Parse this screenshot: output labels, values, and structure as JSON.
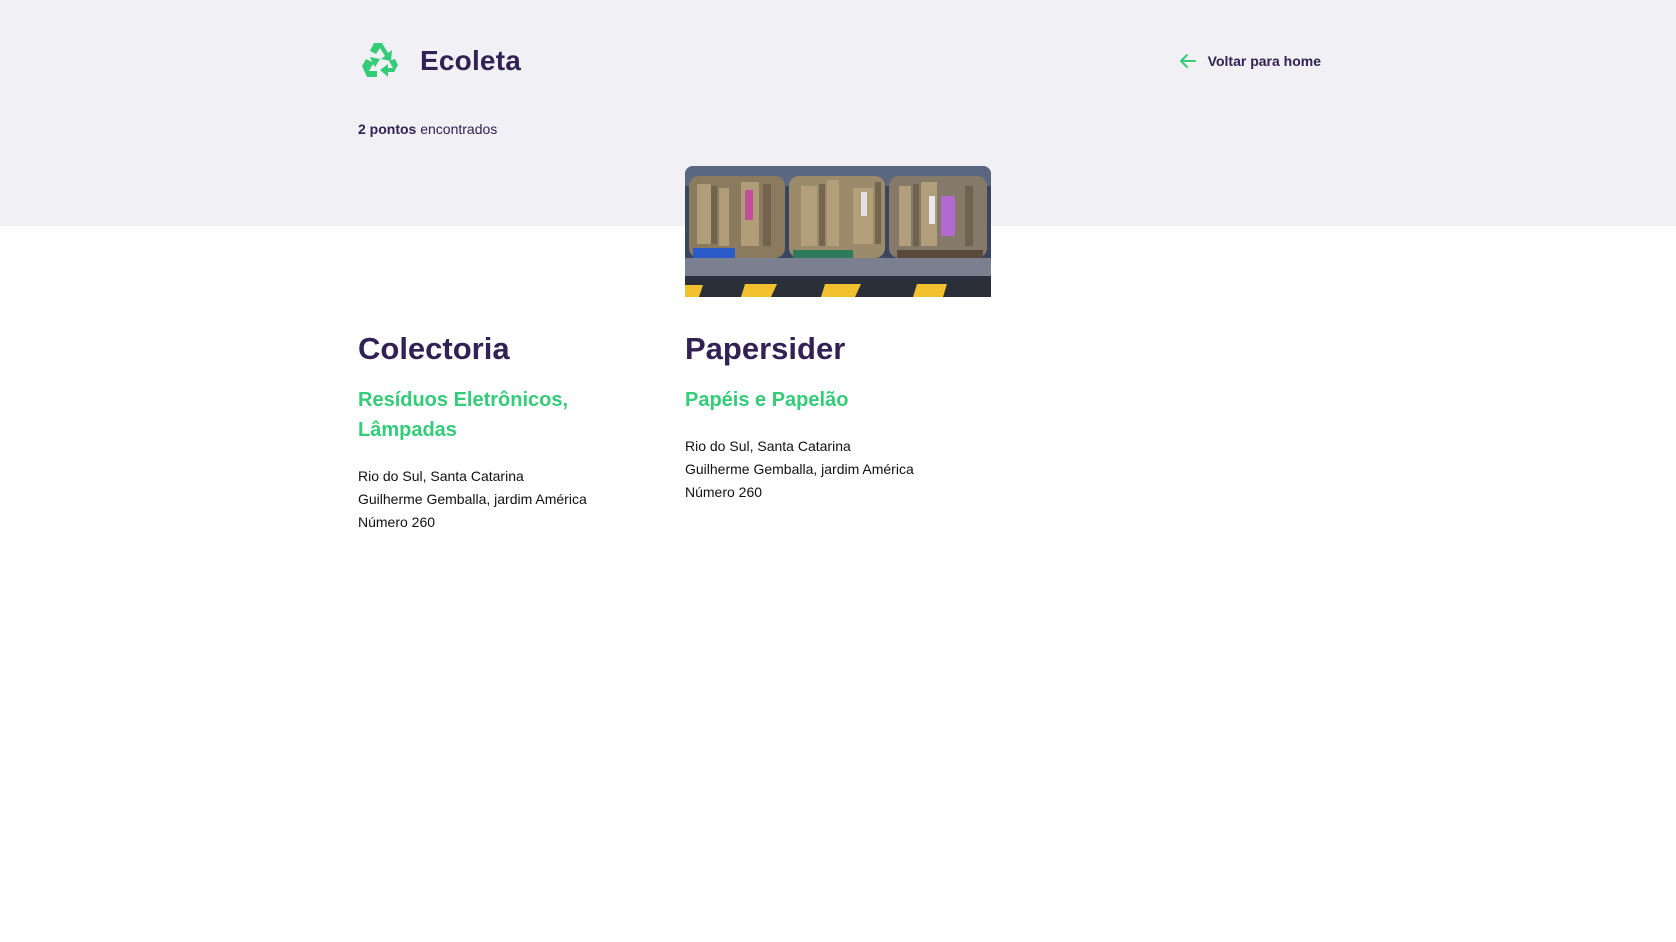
{
  "app": {
    "name": "Ecoleta",
    "logo_icon": "recycle-icon"
  },
  "header": {
    "back_label": "Voltar para home",
    "back_icon": "arrow-left-icon"
  },
  "results": {
    "count_strong": "2 pontos",
    "count_rest": " encontrados"
  },
  "cards": [
    {
      "title": "Colectoria",
      "items": "Resíduos Eletrônicos, Lâmpadas",
      "address_line1": "Rio do Sul, Santa Catarina",
      "address_line2": "Guilherme Gemballa, jardim América",
      "address_line3": "Número 260"
    },
    {
      "title": "Papersider",
      "items": "Papéis e Papelão",
      "address_line1": "Rio do Sul, Santa Catarina",
      "address_line2": "Guilherme Gemballa, jardim América",
      "address_line3": "Número 260",
      "image": "cardboard-bales-photo"
    }
  ],
  "colors": {
    "primary": "#322153",
    "accent": "#34cb79",
    "background_top": "#f0f0f5"
  }
}
